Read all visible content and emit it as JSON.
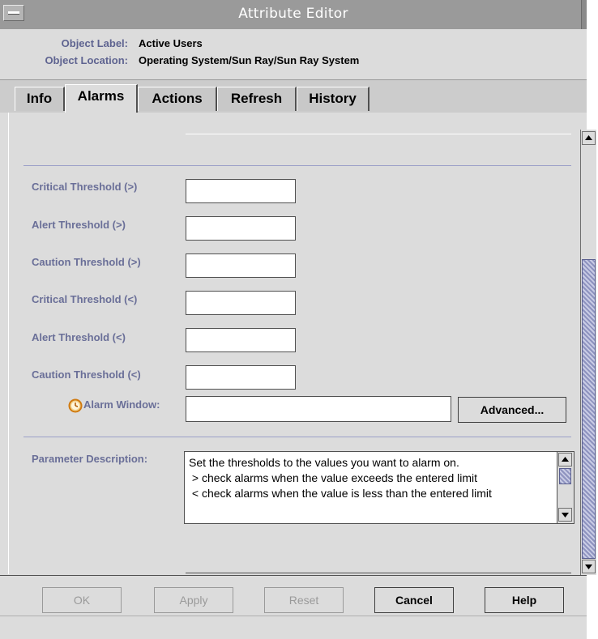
{
  "window": {
    "title": "Attribute Editor"
  },
  "object": {
    "label_key": "Object Label:",
    "label_value": "Active Users",
    "location_key": "Object Location:",
    "location_value": "Operating System/Sun Ray/Sun Ray System"
  },
  "tabs": [
    {
      "label": "Info",
      "active": false
    },
    {
      "label": "Alarms",
      "active": true
    },
    {
      "label": "Actions",
      "active": false
    },
    {
      "label": "Refresh",
      "active": false
    },
    {
      "label": "History",
      "active": false
    }
  ],
  "fields": [
    {
      "label": "Critical Threshold (>)",
      "value": ""
    },
    {
      "label": "Alert Threshold (>)",
      "value": ""
    },
    {
      "label": "Caution Threshold (>)",
      "value": ""
    },
    {
      "label": "Critical Threshold (<)",
      "value": ""
    },
    {
      "label": "Alert Threshold (<)",
      "value": ""
    },
    {
      "label": "Caution Threshold (<)",
      "value": ""
    }
  ],
  "alarm_window": {
    "label": "Alarm Window:",
    "value": "",
    "icon": "clock-icon",
    "advanced_label": "Advanced..."
  },
  "description": {
    "label": "Parameter Description:",
    "text": "Set the thresholds to the values you want to alarm on.\n > check alarms when the value exceeds the entered limit\n < check alarms when the value is less than the entered limit"
  },
  "buttons": [
    {
      "label": "OK",
      "enabled": false
    },
    {
      "label": "Apply",
      "enabled": false
    },
    {
      "label": "Reset",
      "enabled": false
    },
    {
      "label": "Cancel",
      "enabled": true
    },
    {
      "label": "Help",
      "enabled": true
    }
  ],
  "colors": {
    "label": "#6a6f98",
    "divider": "#9ca0c8",
    "scroll_thumb": "#8e93bf"
  }
}
